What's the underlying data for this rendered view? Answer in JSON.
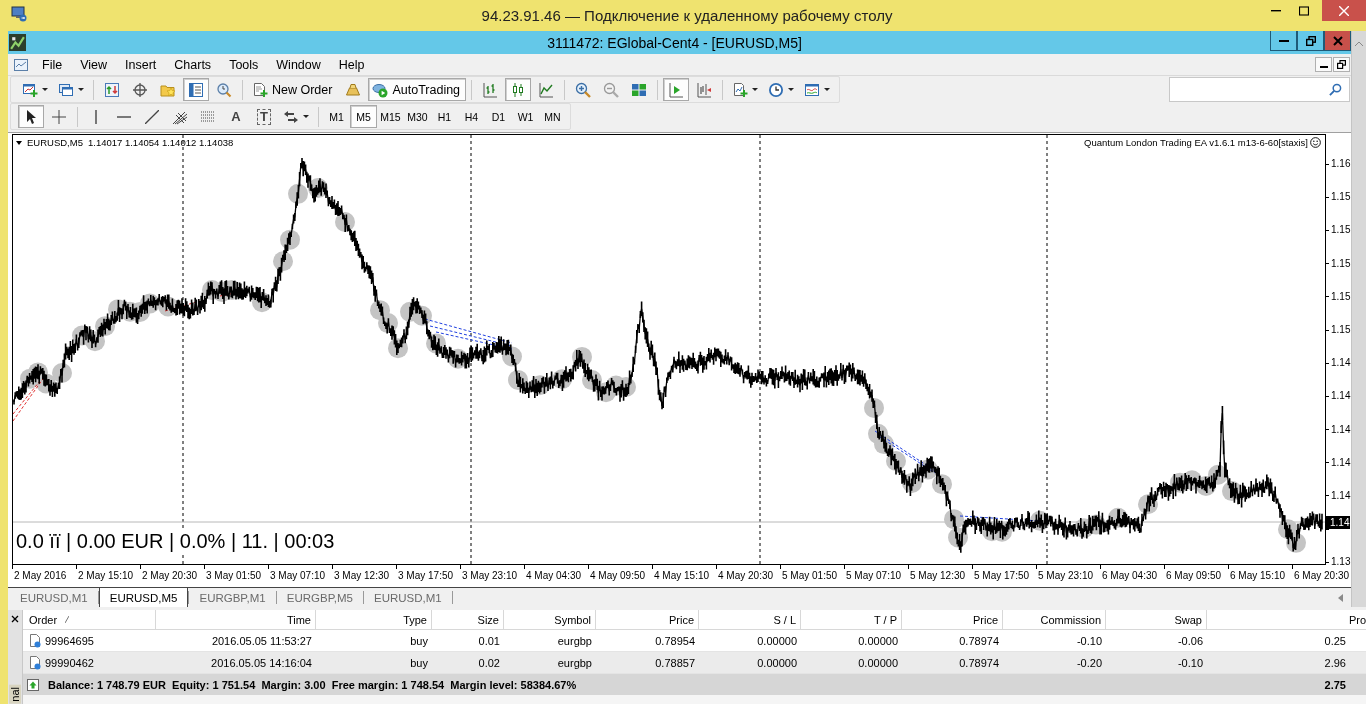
{
  "rdp_window": {
    "title": "94.23.91.46 — Подключение к удаленному рабочему столу"
  },
  "app_window": {
    "title": "3111472: EGlobal-Cent4 - [EURUSD,M5]"
  },
  "menu": [
    "File",
    "View",
    "Insert",
    "Charts",
    "Tools",
    "Window",
    "Help"
  ],
  "toolbar": [
    {
      "on": false
    },
    {
      "on": false
    },
    {
      "on": false
    },
    {
      "on": false
    },
    {
      "on": false
    },
    {
      "on": true
    },
    {
      "on": false
    },
    {
      "label": "New Order",
      "on": false
    },
    {
      "on": false
    },
    {
      "label": "AutoTrading",
      "on": true
    },
    {
      "on": false
    },
    {
      "on": true
    },
    {
      "on": false
    },
    {
      "on": false
    },
    {
      "on": false
    },
    {
      "on": false
    },
    {
      "on": true
    },
    {
      "on": false
    },
    {
      "on": false
    },
    {
      "on": false
    },
    {
      "on": false
    }
  ],
  "drawing_toolbar": [
    {
      "on": true
    },
    {
      "on": false
    },
    {
      "on": false
    },
    {
      "on": false
    },
    {
      "on": false
    },
    {
      "on": false
    },
    {
      "on": false
    },
    {
      "label": "A",
      "on": false
    },
    {
      "label": "T",
      "on": false
    },
    {
      "on": false
    }
  ],
  "timeframes": [
    {
      "label": "M1",
      "selected": false
    },
    {
      "label": "M5",
      "selected": true
    },
    {
      "label": "M15",
      "selected": false
    },
    {
      "label": "M30",
      "selected": false
    },
    {
      "label": "H1",
      "selected": false
    },
    {
      "label": "H4",
      "selected": false
    },
    {
      "label": "D1",
      "selected": false
    },
    {
      "label": "W1",
      "selected": false
    },
    {
      "label": "MN",
      "selected": false
    }
  ],
  "chart": {
    "symbol": "EURUSD,M5",
    "ohlc": "1.14017 1.14054 1.14012 1.14038",
    "expert": "Quantum London Trading EA v1.6.1 m13-6-60[staxis]",
    "info": "0.0 ïï | 0.00 EUR | 0.0% | 11. | 00:03",
    "price_labels": [
      {
        "label": "1.16",
        "kind": "tick"
      },
      {
        "label": "1.15",
        "kind": "tick"
      },
      {
        "label": "1.15",
        "kind": "tick"
      },
      {
        "label": "1.15",
        "kind": "tick"
      },
      {
        "label": "1.15",
        "kind": "tick"
      },
      {
        "label": "1.15",
        "kind": "tick"
      },
      {
        "label": "1.14",
        "kind": "tick"
      },
      {
        "label": "1.14",
        "kind": "tick"
      },
      {
        "label": "1.14",
        "kind": "tick"
      },
      {
        "label": "1.14",
        "kind": "tick"
      },
      {
        "label": "1.14",
        "kind": "tick"
      },
      {
        "label": "1.14",
        "kind": "current"
      },
      {
        "label": "1.13",
        "kind": "tick"
      }
    ],
    "time_labels": [
      "2 May 2016",
      "2 May 15:10",
      "2 May 20:30",
      "3 May 01:50",
      "3 May 07:10",
      "3 May 12:30",
      "3 May 17:50",
      "3 May 23:10",
      "4 May 04:30",
      "4 May 09:50",
      "4 May 15:10",
      "4 May 20:30",
      "5 May 01:50",
      "5 May 07:10",
      "5 May 12:30",
      "5 May 17:50",
      "5 May 23:10",
      "6 May 04:30",
      "6 May 09:50",
      "6 May 15:10",
      "6 May 20:30"
    ]
  },
  "chart_tabs": [
    {
      "label": "EURUSD,M1",
      "selected": false
    },
    {
      "label": "EURUSD,M5",
      "selected": true
    },
    {
      "label": "EURGBP,M1",
      "selected": false
    },
    {
      "label": "EURGBP,M5",
      "selected": false
    },
    {
      "label": "EURUSD,M1",
      "selected": false
    }
  ],
  "terminal": {
    "side_label": "nal",
    "columns": [
      "Order",
      "Time",
      "Type",
      "Size",
      "Symbol",
      "Price",
      "S / L",
      "T / P",
      "Price",
      "Commission",
      "Swap",
      "Pro"
    ],
    "rows": [
      [
        "99964695",
        "2016.05.05 11:53:27",
        "buy",
        "0.01",
        "eurgbp",
        "0.78954",
        "0.00000",
        "0.00000",
        "0.78974",
        "-0.10",
        "-0.06",
        "0.25"
      ],
      [
        "99990462",
        "2016.05.05 14:16:04",
        "buy",
        "0.02",
        "eurgbp",
        "0.78857",
        "0.00000",
        "0.00000",
        "0.78974",
        "-0.20",
        "-0.10",
        "2.96"
      ]
    ],
    "summary": "Balance: 1 748.79 EUR  Equity: 1 751.54  Margin: 3.00  Free margin: 1 748.54  Margin level: 58384.67%",
    "summary_value": "2.75"
  }
}
